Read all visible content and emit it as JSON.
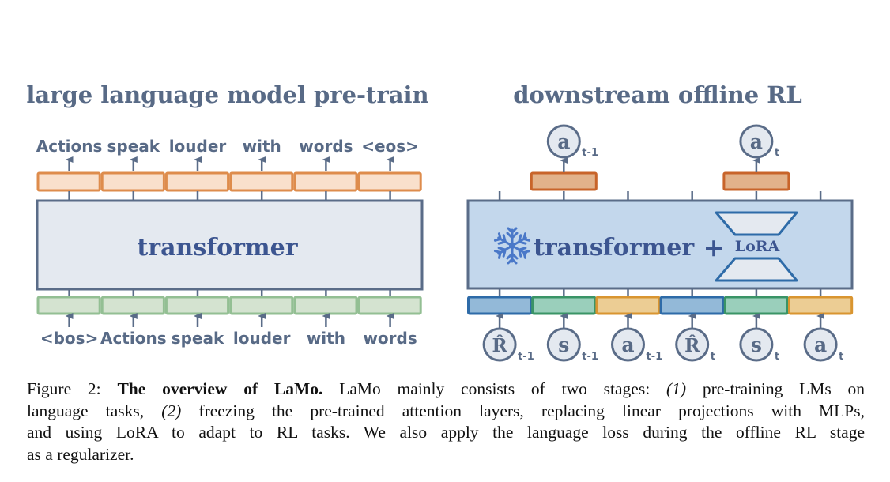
{
  "figure": {
    "left": {
      "title": "large language model pre-train",
      "model_label": "transformer",
      "output_tokens": [
        "Actions",
        "speak",
        "louder",
        "with",
        "words",
        "<eos>"
      ],
      "input_tokens": [
        "<bos>",
        "Actions",
        "speak",
        "louder",
        "with",
        "words"
      ]
    },
    "right": {
      "title": "downstream offline RL",
      "model_label": "transformer",
      "plus": "+",
      "adapter_label": "LoRA",
      "frozen_icon": "snowflake-icon",
      "outputs": [
        {
          "symbol": "a",
          "sub": "t-1",
          "slot": 1
        },
        {
          "symbol": "a",
          "sub": "t",
          "slot": 4
        }
      ],
      "inputs": [
        {
          "symbol": "R̂",
          "sub": "t-1",
          "kind": "return"
        },
        {
          "symbol": "s",
          "sub": "t-1",
          "kind": "state"
        },
        {
          "symbol": "a",
          "sub": "t-1",
          "kind": "action"
        },
        {
          "symbol": "R̂",
          "sub": "t",
          "kind": "return"
        },
        {
          "symbol": "s",
          "sub": "t",
          "kind": "state"
        },
        {
          "symbol": "a",
          "sub": "t",
          "kind": "action"
        }
      ]
    },
    "colors": {
      "text": "#586a86",
      "model_text": "#3c5590",
      "lm_output_fill": "#f9e0cc",
      "lm_output_stroke": "#de8c4c",
      "lm_input_fill": "#d4e3d0",
      "lm_input_stroke": "#93bf93",
      "lm_box_fill": "#e4e9f0",
      "rl_box_fill": "#c3d7ec",
      "box_stroke": "#5a6c88",
      "rl_output_fill": "#e2b28a",
      "rl_output_stroke": "#c8642a",
      "return_fill": "#93b9d8",
      "return_stroke": "#2e6ba8",
      "state_fill": "#9acfbb",
      "state_stroke": "#3a9466",
      "action_fill": "#eccd94",
      "action_stroke": "#d99530",
      "circle_fill": "#e4e9f0",
      "snowflake": "#4a78c8"
    }
  },
  "caption": {
    "label": "Figure 2:",
    "bold": "The overview of LaMo.",
    "lines": [
      {
        "parts": [
          {
            "t": "Figure 2: ",
            "s": "n"
          },
          {
            "t": "The overview of LaMo.",
            "s": "b"
          },
          {
            "t": " LaMo mainly consists of two stages: ",
            "s": "n"
          },
          {
            "t": "(1)",
            "s": "i"
          },
          {
            "t": " pre-training LMs on",
            "s": "n"
          }
        ]
      },
      {
        "parts": [
          {
            "t": "language tasks, ",
            "s": "n"
          },
          {
            "t": "(2)",
            "s": "i"
          },
          {
            "t": " freezing the pre-trained attention layers, replacing linear projections with MLPs,",
            "s": "n"
          }
        ]
      },
      {
        "parts": [
          {
            "t": "and using LoRA to adapt to RL tasks. We also apply the language loss during the offline RL stage",
            "s": "n"
          }
        ]
      },
      {
        "parts": [
          {
            "t": "as a regularizer.",
            "s": "n"
          }
        ]
      }
    ]
  }
}
